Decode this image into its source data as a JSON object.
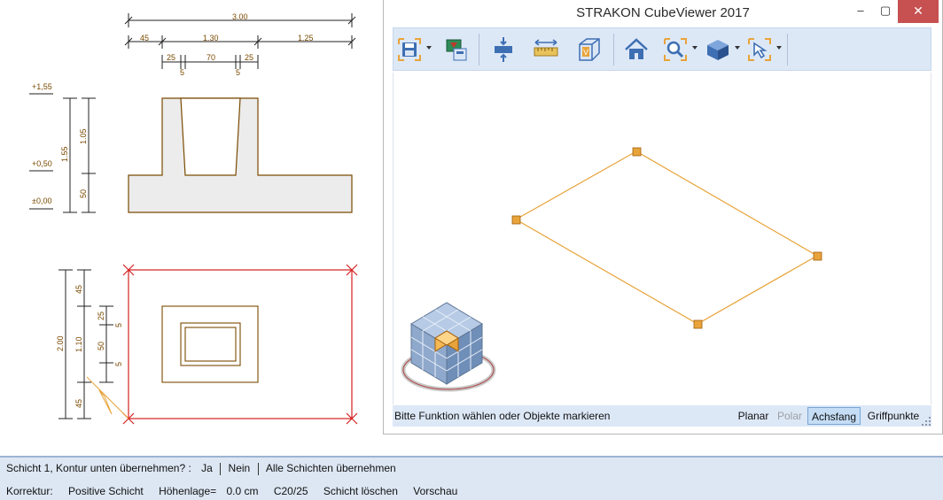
{
  "drawing": {
    "dim_top_total": "3.00",
    "dim_top_segments": [
      "45",
      "1.30",
      "1.25"
    ],
    "dim_top_detail": [
      "25",
      "70",
      "25"
    ],
    "dim_top_small": [
      "5",
      "5"
    ],
    "elev_labels": [
      "+1,55",
      "+0,50",
      "±0,00"
    ],
    "dim_left_total": "1.55",
    "dim_left_segments": [
      "1.05",
      "50"
    ],
    "plan_dim_total": "2.00",
    "plan_dim_segments": [
      "45",
      "1.10",
      "45"
    ],
    "plan_dim_inner": [
      "25",
      "50",
      "5",
      "5"
    ]
  },
  "window": {
    "title": "STRAKON CubeViewer 2017",
    "minimize": "–",
    "maximize": "▢",
    "close": "✕"
  },
  "status": {
    "message": "Bitte Funktion wählen oder Objekte markieren",
    "buttons": [
      "Planar",
      "Polar",
      "Achsfang",
      "Griffpunkte"
    ],
    "active": "Achsfang"
  },
  "command": {
    "prompt": "Schicht 1, Kontur unten übernehmen? :",
    "options": [
      "Ja",
      "Nein",
      "Alle Schichten übernehmen"
    ],
    "row2": [
      "Korrektur:",
      "Positive Schicht",
      "Höhenlage=",
      "0.0 cm",
      "C20/25",
      "Schicht löschen",
      "Vorschau"
    ]
  },
  "colors": {
    "accent": "#e8a33a",
    "toolbar": "#dde8f7",
    "dim": "#7a4a00",
    "section_fill": "#ececec",
    "plan_red": "#d42020"
  }
}
